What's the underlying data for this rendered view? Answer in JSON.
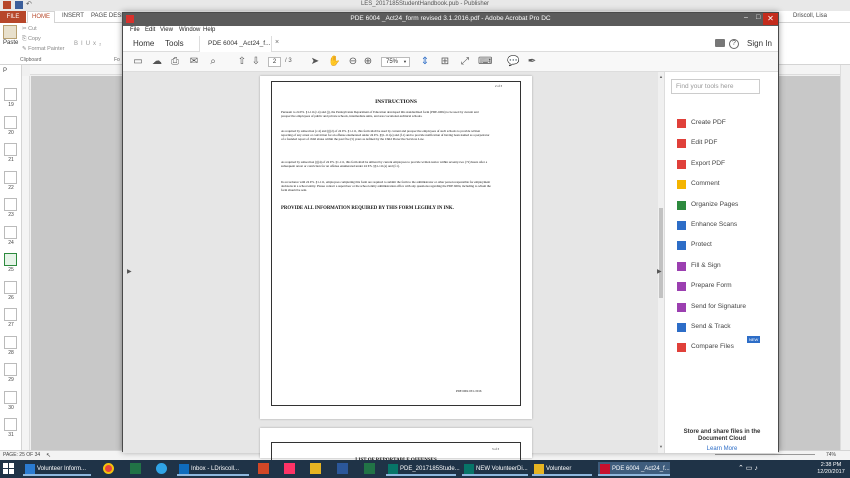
{
  "publisher": {
    "window_title": "LES_2017185StudentHandbook.pub - Publisher",
    "user_name": "Driscoll, Lisa",
    "tabs": [
      "FILE",
      "HOME",
      "INSERT",
      "PAGE DESIGN"
    ],
    "clipboard": {
      "paste": "Paste",
      "cut": "Cut",
      "copy": "Copy",
      "format_painter": "Format Painter",
      "group": "Clipboard"
    },
    "font_group": "Fo",
    "format_buttons": [
      "B",
      "I",
      "U",
      "x₂"
    ],
    "pages_label": "P",
    "page_numbers": [
      "19",
      "20",
      "21",
      "22",
      "23",
      "24",
      "25",
      "26",
      "27",
      "28",
      "29",
      "30",
      "31"
    ],
    "status": {
      "page": "PAGE: 25 OF 34",
      "zoom": "74%"
    }
  },
  "acrobat": {
    "window_title": "PDE 6004 _Act24_form revised 3.1.2016.pdf - Adobe Acrobat Pro DC",
    "menu": [
      "File",
      "Edit",
      "View",
      "Window",
      "Help"
    ],
    "nav": {
      "home": "Home",
      "tools": "Tools",
      "doc_tab": "PDE 6004 _Act24_f...",
      "sign_in": "Sign In"
    },
    "toolbar": {
      "page_current": "2",
      "page_total": "/ 3",
      "zoom": "75%"
    },
    "tools_search_placeholder": "Find your tools here",
    "tools": [
      {
        "label": "Create PDF",
        "color": "#e0403a"
      },
      {
        "label": "Edit PDF",
        "color": "#e0403a"
      },
      {
        "label": "Export PDF",
        "color": "#e0403a"
      },
      {
        "label": "Comment",
        "color": "#f4b400"
      },
      {
        "label": "Organize Pages",
        "color": "#2d8a3e"
      },
      {
        "label": "Enhance Scans",
        "color": "#2d6dc7"
      },
      {
        "label": "Protect",
        "color": "#2d6dc7"
      },
      {
        "label": "Fill & Sign",
        "color": "#9b3fb0"
      },
      {
        "label": "Prepare Form",
        "color": "#9b3fb0"
      },
      {
        "label": "Send for Signature",
        "color": "#9b3fb0"
      },
      {
        "label": "Send & Track",
        "color": "#2d6dc7"
      },
      {
        "label": "Compare Files",
        "color": "#e0403a",
        "badge": "NEW"
      }
    ],
    "store_share": "Store and share files in the Document Cloud",
    "learn_more": "Learn More"
  },
  "pdf": {
    "page1": {
      "page_no": "2 of 3",
      "heading": "INSTRUCTIONS",
      "paragraphs": [
        "Pursuant to 24 P.S. §1-111(c.4) and (j), the Pennsylvania Department of Education developed this standardized form (PDE-6004) to be used by current and prospective employees of public and private schools, intermediate units, and area vocational-technical schools.",
        "As required by subsection (c.4) and (j)(2) of 24 P.S. §1-111, this form shall be used by current and prospective employees of such schools to provide written reporting of any arrest or conviction for an offense enumerated under 24 P.S. §§1-111(e) and (f.1) and to provide notification of having been named as a perpetrator of a founded report of child abuse within the past five (5) years as defined by the Child Protective Services Law.",
        "As required by subsection (j)(4) of 24 P.S. §1-111, this form shall be utilized by current employees to provide written notice within seventy-two (72) hours after a subsequent arrest or conviction for an offense enumerated under 24 P.S. §§1-111(e) and (f.1).",
        "In accordance with 24 P.S. §1-111, employees completing this form are required to submit the form to the administrator or other person responsible for employment decisions in a school entity. Please contact a supervisor or the school entity administration office with any questions regarding the PDE 6004, including to whom the form should be sent."
      ],
      "bold_line": "PROVIDE ALL INFORMATION REQUIRED BY THIS FORM LEGIBLY IN INK.",
      "footer": "PDE 6004 03/1/2016"
    },
    "page2": {
      "page_no": "3 of 3",
      "heading": "LIST OF REPORTABLE OFFENSES"
    }
  },
  "taskbar": {
    "apps": [
      {
        "label": "Volunteer Inform...",
        "color": "#2b7bd1"
      },
      {
        "label": "Inbox - LDriscoll...",
        "color": "#0f6cbd"
      },
      {
        "label": "PDE_2017185Stude...",
        "color": "#077568"
      },
      {
        "label": "NEW VolunteerDi...",
        "color": "#077568"
      },
      {
        "label": "Volunteer",
        "color": "#e6b422"
      },
      {
        "label": "PDE 6004 _Act24_f...",
        "color": "#c8102e"
      }
    ],
    "time": "2:38 PM",
    "date": "12/20/2017"
  }
}
